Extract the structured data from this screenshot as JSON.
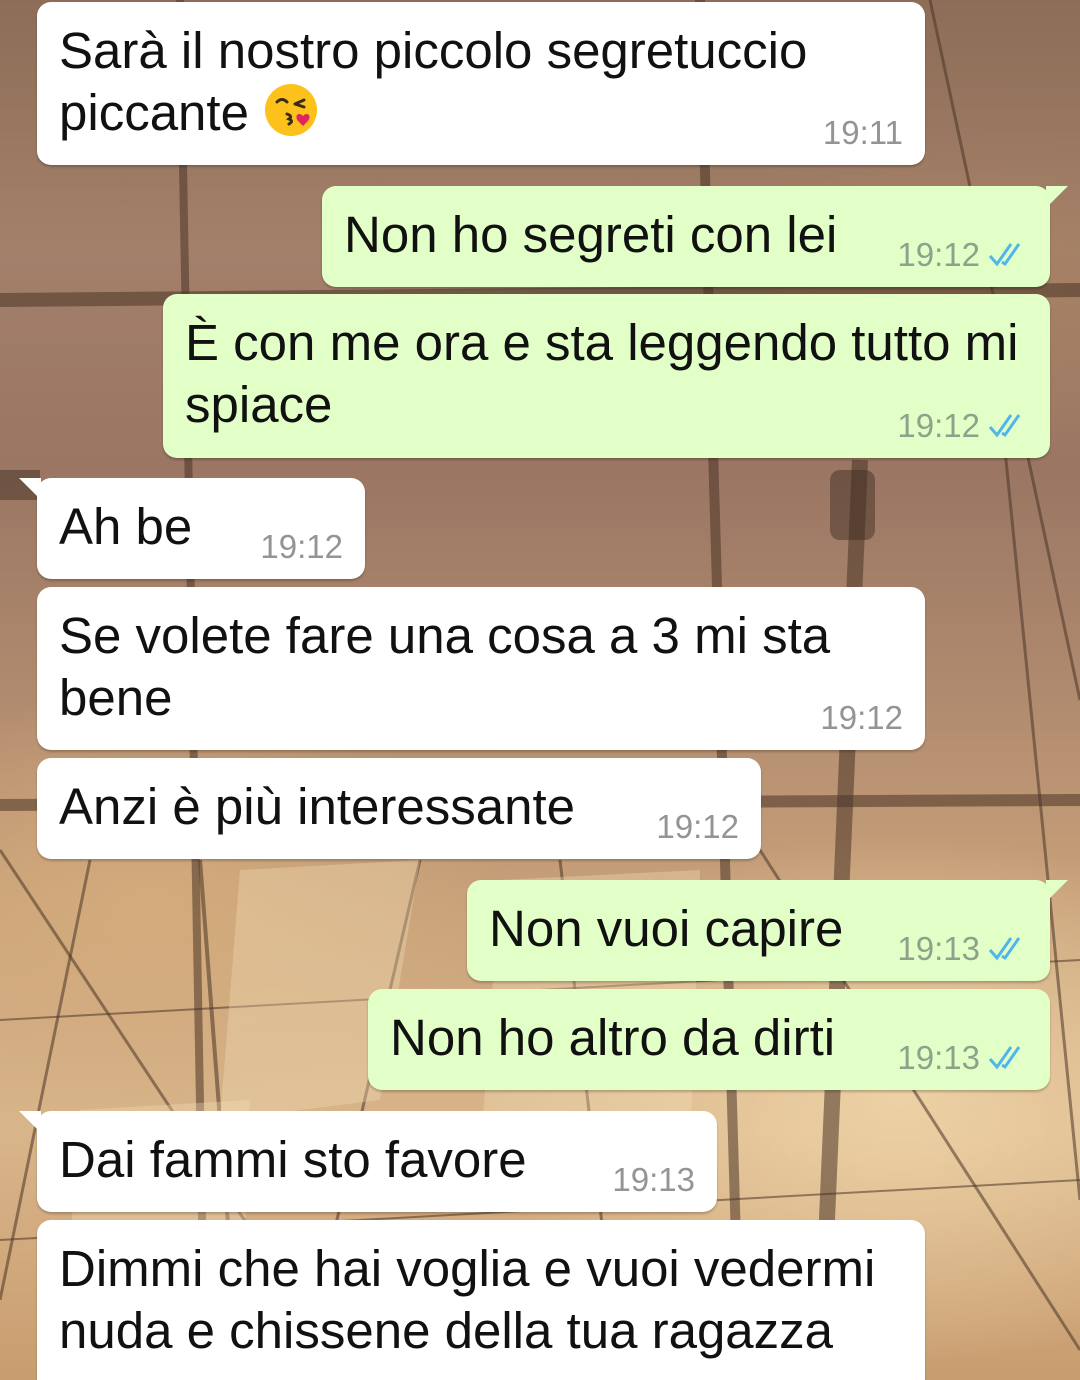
{
  "messages": [
    {
      "direction": "in",
      "text": "Sarà il nostro piccolo segretuccio piccante",
      "time": "19:11",
      "emoji": "face-blowing-a-kiss"
    },
    {
      "direction": "out",
      "text": "Non ho segreti con lei",
      "time": "19:12",
      "status": "read"
    },
    {
      "direction": "out",
      "text": "È con me ora e sta leggendo tutto mi spiace",
      "time": "19:12",
      "status": "read"
    },
    {
      "direction": "in",
      "text": "Ah be",
      "time": "19:12"
    },
    {
      "direction": "in",
      "text": "Se volete fare una cosa a 3 mi sta bene",
      "time": "19:12"
    },
    {
      "direction": "in",
      "text": "Anzi è più interessante",
      "time": "19:12"
    },
    {
      "direction": "out",
      "text": "Non vuoi capire",
      "time": "19:13",
      "status": "read"
    },
    {
      "direction": "out",
      "text": "Non ho altro da dirti",
      "time": "19:13",
      "status": "read"
    },
    {
      "direction": "in",
      "text": "Dai fammi sto favore",
      "time": "19:13"
    },
    {
      "direction": "in",
      "text": "Dimmi che hai voglia e vuoi vedermi nuda e chissene della tua ragazza",
      "time": ""
    }
  ],
  "colors": {
    "incoming_bubble": "#ffffff",
    "outgoing_bubble": "#e2ffc7",
    "read_ticks": "#4fb6ec",
    "timestamp": "#949494"
  },
  "icons": {
    "read_receipt": "double-check-icon",
    "emoji": "face-blowing-a-kiss-emoji"
  }
}
